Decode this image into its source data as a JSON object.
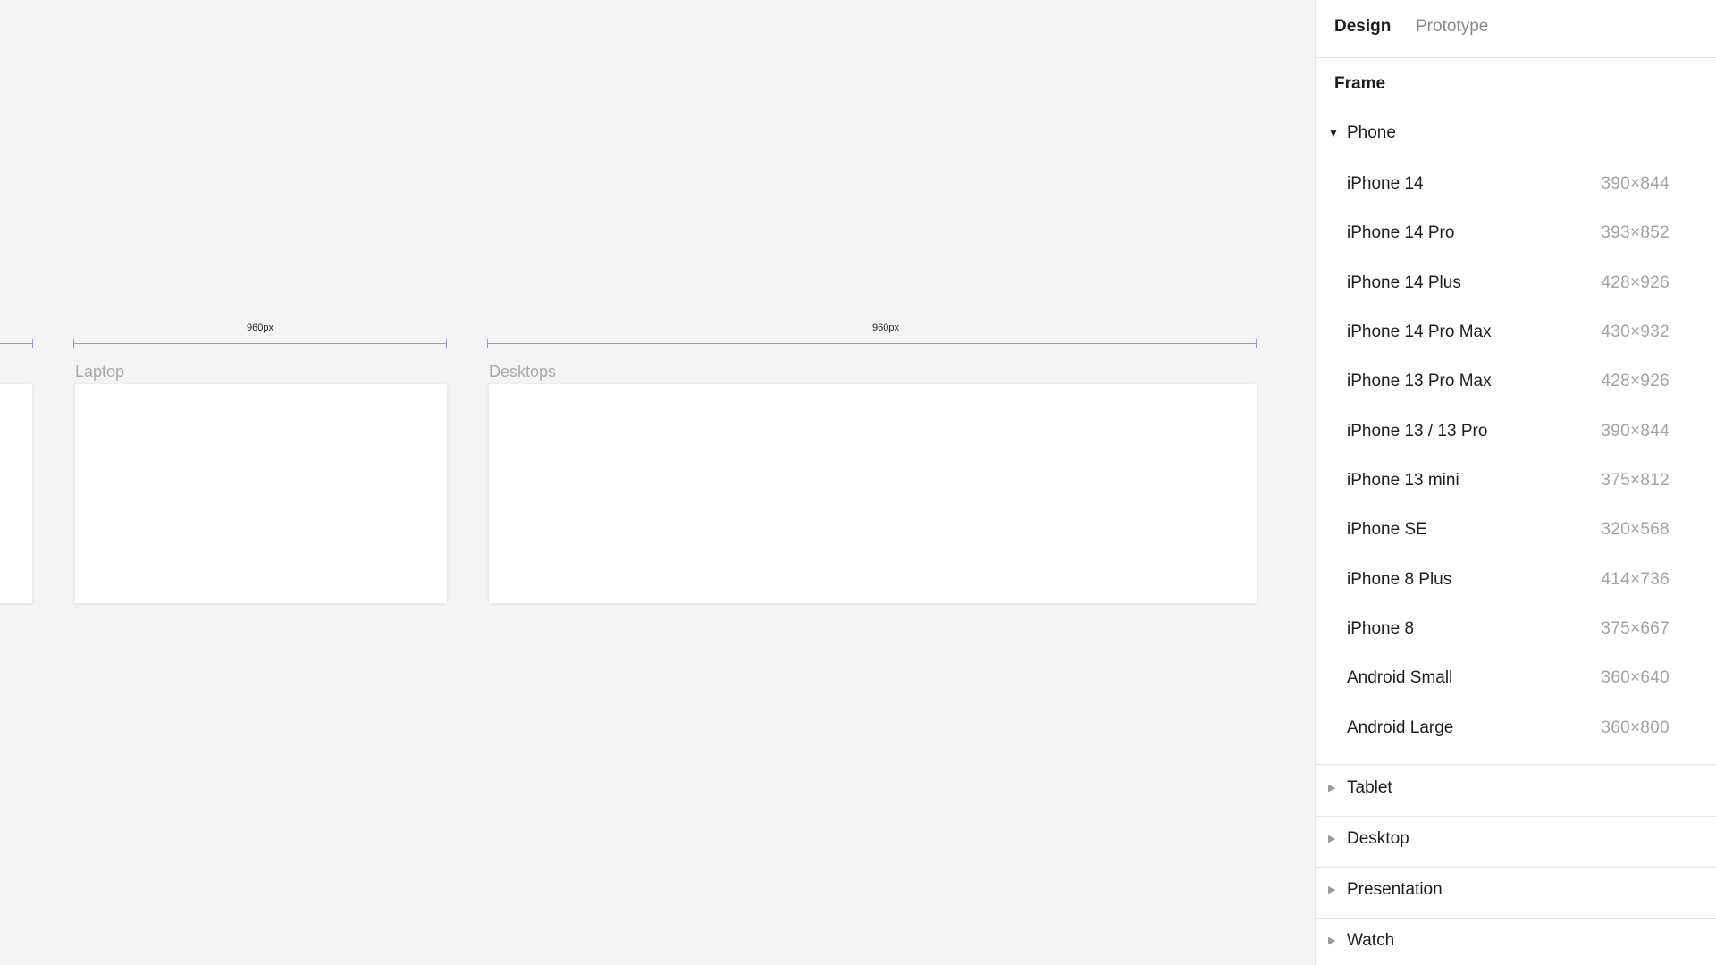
{
  "canvas": {
    "ruler_label": "960px",
    "frames": {
      "laptop": {
        "label": "Laptop"
      },
      "desktops": {
        "label": "Desktops"
      }
    }
  },
  "panel": {
    "tabs": {
      "design": "Design",
      "prototype": "Prototype"
    },
    "section_title": "Frame",
    "phone_group": {
      "label": "Phone",
      "presets": [
        {
          "name": "iPhone 14",
          "size": "390×844"
        },
        {
          "name": "iPhone 14 Pro",
          "size": "393×852"
        },
        {
          "name": "iPhone 14 Plus",
          "size": "428×926"
        },
        {
          "name": "iPhone 14 Pro Max",
          "size": "430×932"
        },
        {
          "name": "iPhone 13 Pro Max",
          "size": "428×926"
        },
        {
          "name": "iPhone 13 / 13 Pro",
          "size": "390×844"
        },
        {
          "name": "iPhone 13 mini",
          "size": "375×812"
        },
        {
          "name": "iPhone SE",
          "size": "320×568"
        },
        {
          "name": "iPhone 8 Plus",
          "size": "414×736"
        },
        {
          "name": "iPhone 8",
          "size": "375×667"
        },
        {
          "name": "Android Small",
          "size": "360×640"
        },
        {
          "name": "Android Large",
          "size": "360×800"
        }
      ]
    },
    "collapsed_groups": [
      {
        "label": "Tablet"
      },
      {
        "label": "Desktop"
      },
      {
        "label": "Presentation"
      },
      {
        "label": "Watch"
      }
    ]
  },
  "colors": {
    "ruler": "#9a94f0",
    "canvas": "#f4f4f4",
    "panel": "#ffffff"
  }
}
